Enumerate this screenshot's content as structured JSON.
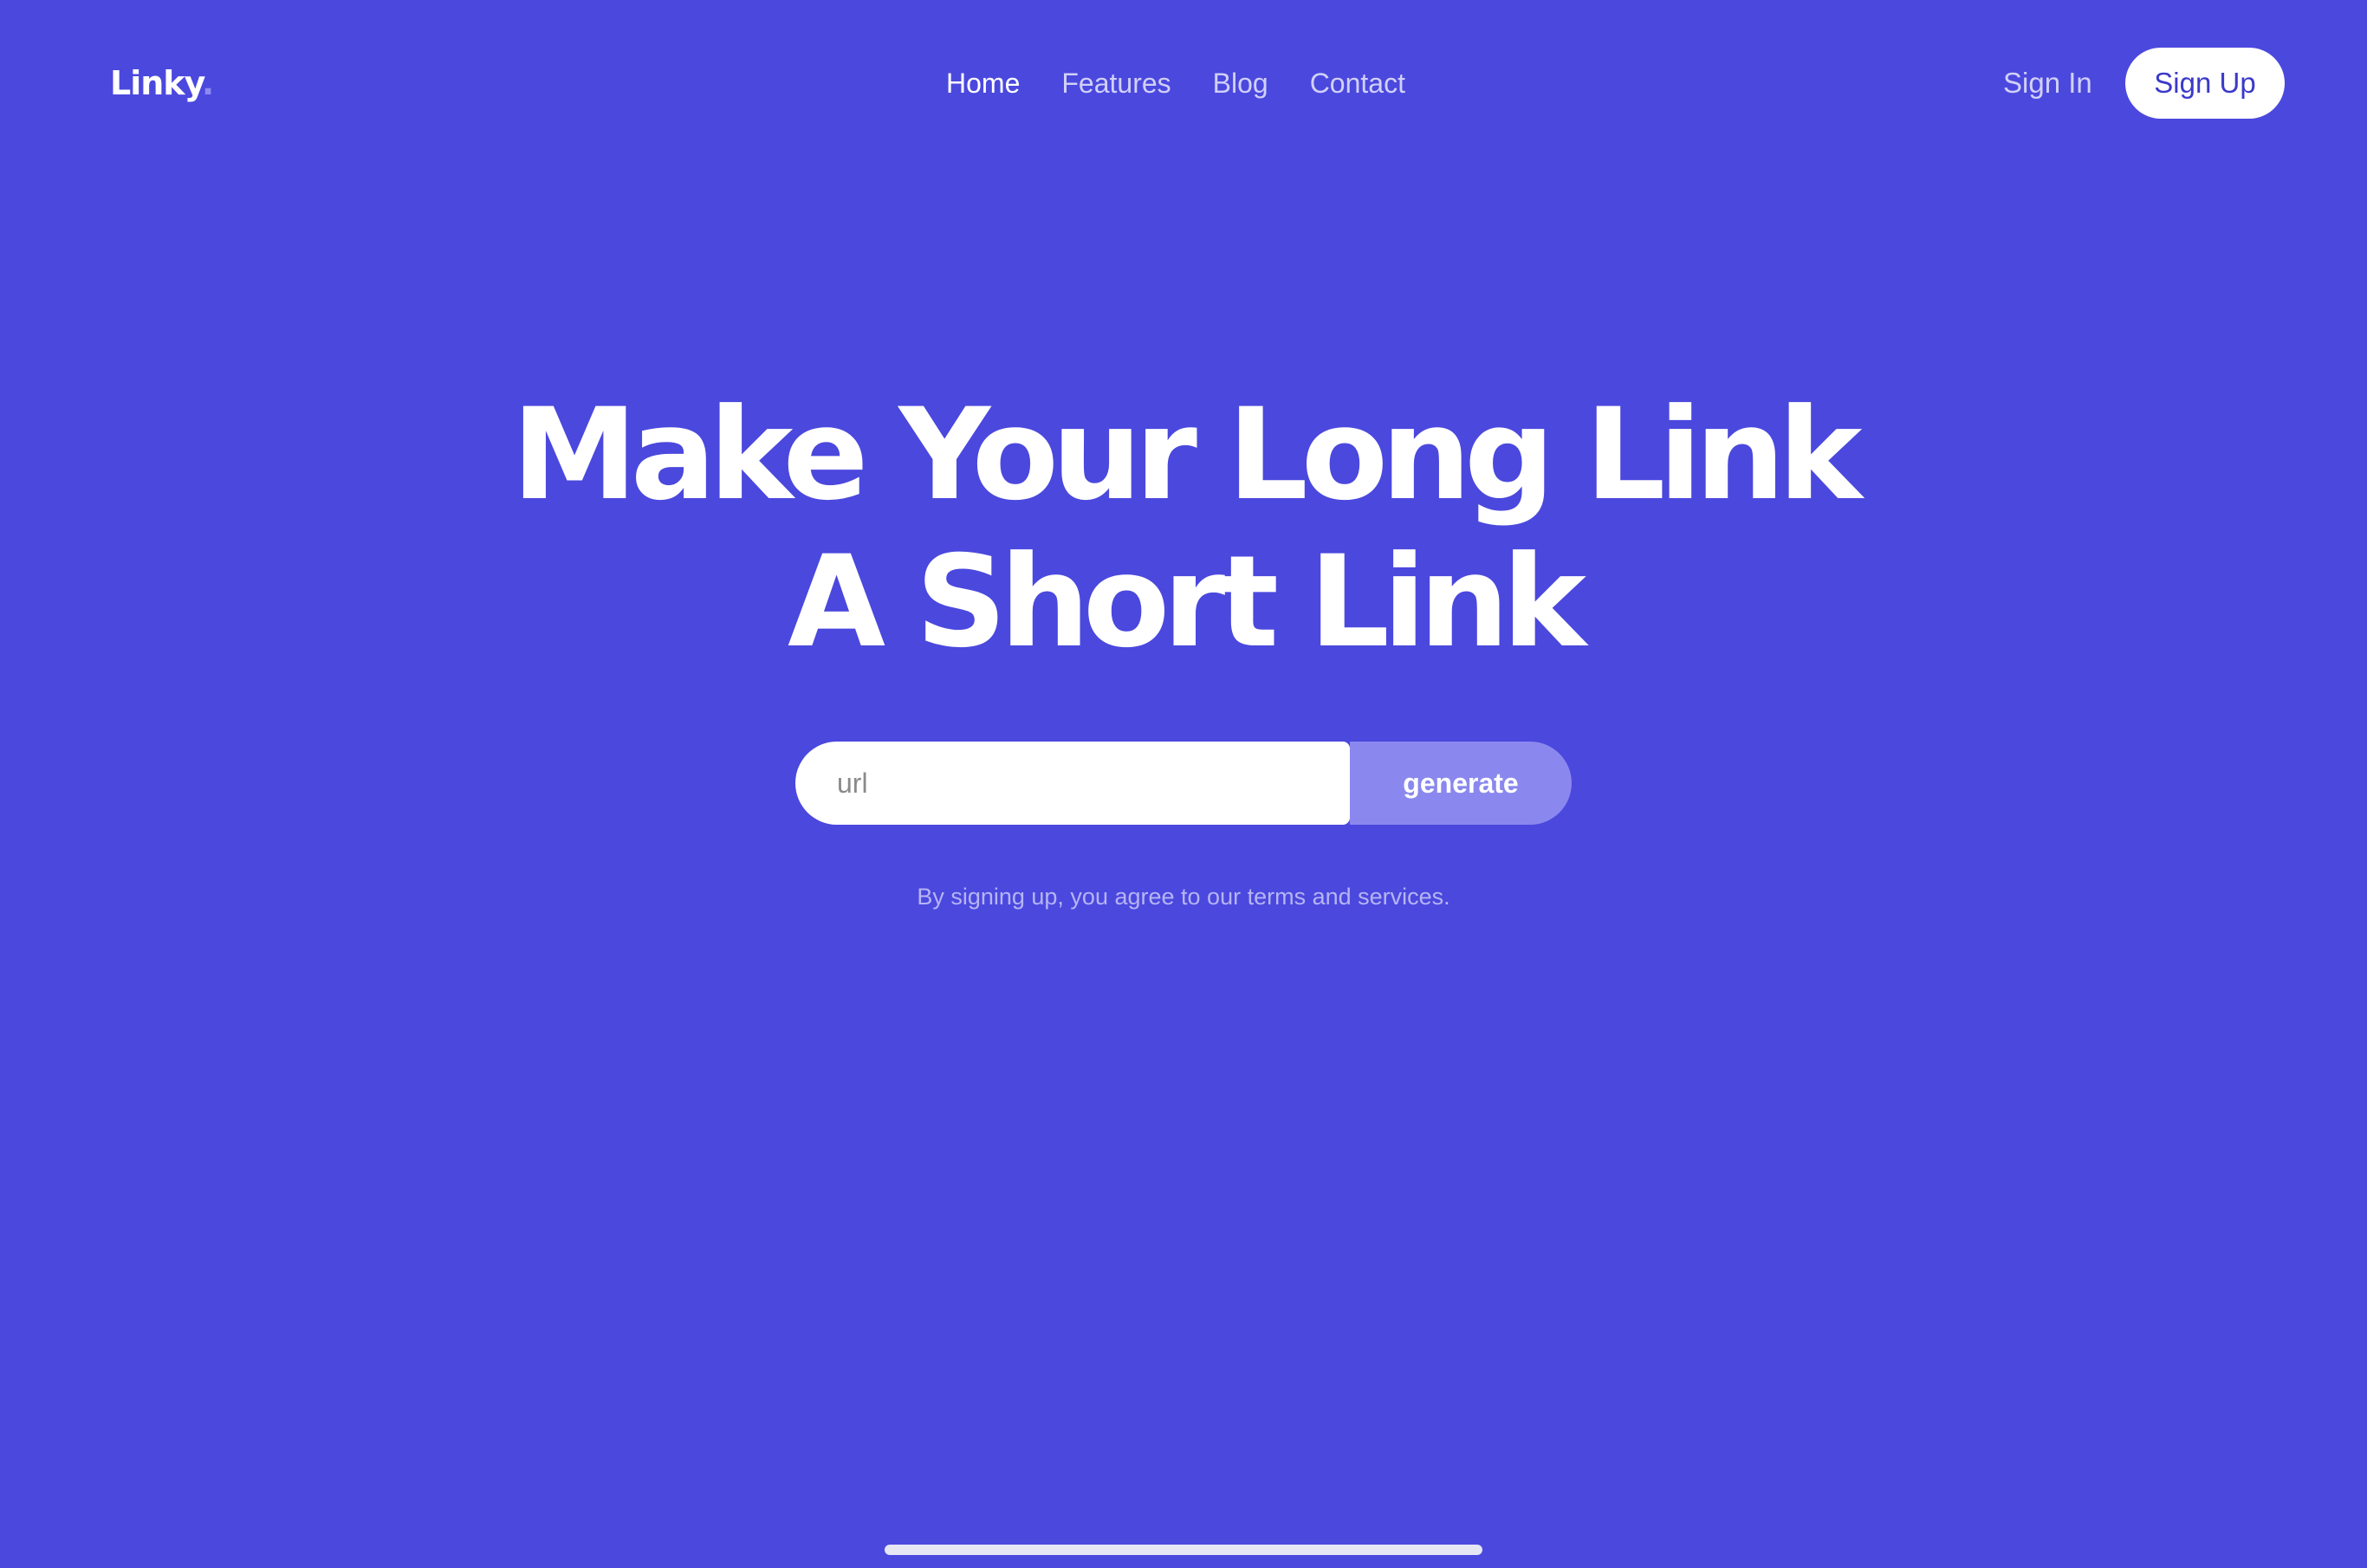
{
  "brand": {
    "name": "Linky",
    "dot": "."
  },
  "nav": {
    "items": [
      {
        "label": "Home",
        "active": true
      },
      {
        "label": "Features",
        "active": false
      },
      {
        "label": "Blog",
        "active": false
      },
      {
        "label": "Contact",
        "active": false
      }
    ]
  },
  "auth": {
    "sign_in": "Sign In",
    "sign_up": "Sign Up"
  },
  "hero": {
    "line1": "Make Your Long Link",
    "line2": "A Short Link"
  },
  "form": {
    "url_placeholder": "url",
    "url_value": "",
    "generate_label": "generate"
  },
  "terms": "By signing up, you agree to our terms and services.",
  "colors": {
    "background": "#4B48DE",
    "generate_button": "#8A88EE",
    "sign_up_text": "#3B39C9"
  }
}
